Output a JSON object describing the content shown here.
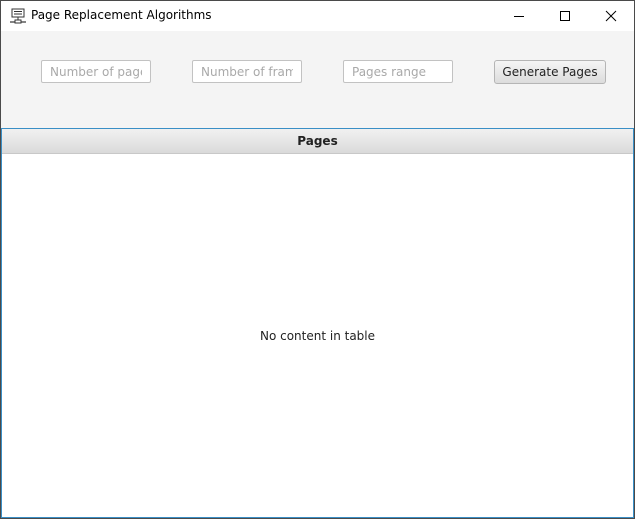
{
  "window": {
    "title": "Page Replacement Algorithms"
  },
  "titlebar_icons": {
    "app": "network-computer-icon",
    "minimize": "minimize-icon",
    "maximize": "maximize-icon",
    "close": "close-icon"
  },
  "inputs": {
    "num_pages": {
      "value": "",
      "placeholder": "Number of pages"
    },
    "num_frames": {
      "value": "",
      "placeholder": "Number of frames"
    },
    "pages_range": {
      "value": "",
      "placeholder": "Pages range"
    }
  },
  "toolbar": {
    "generate_label": "Generate Pages"
  },
  "table": {
    "columns": [
      "Pages"
    ],
    "rows": [],
    "empty_text": "No content in table"
  },
  "colors": {
    "accent_border": "#3a8fc6",
    "background": "#f4f4f4"
  }
}
